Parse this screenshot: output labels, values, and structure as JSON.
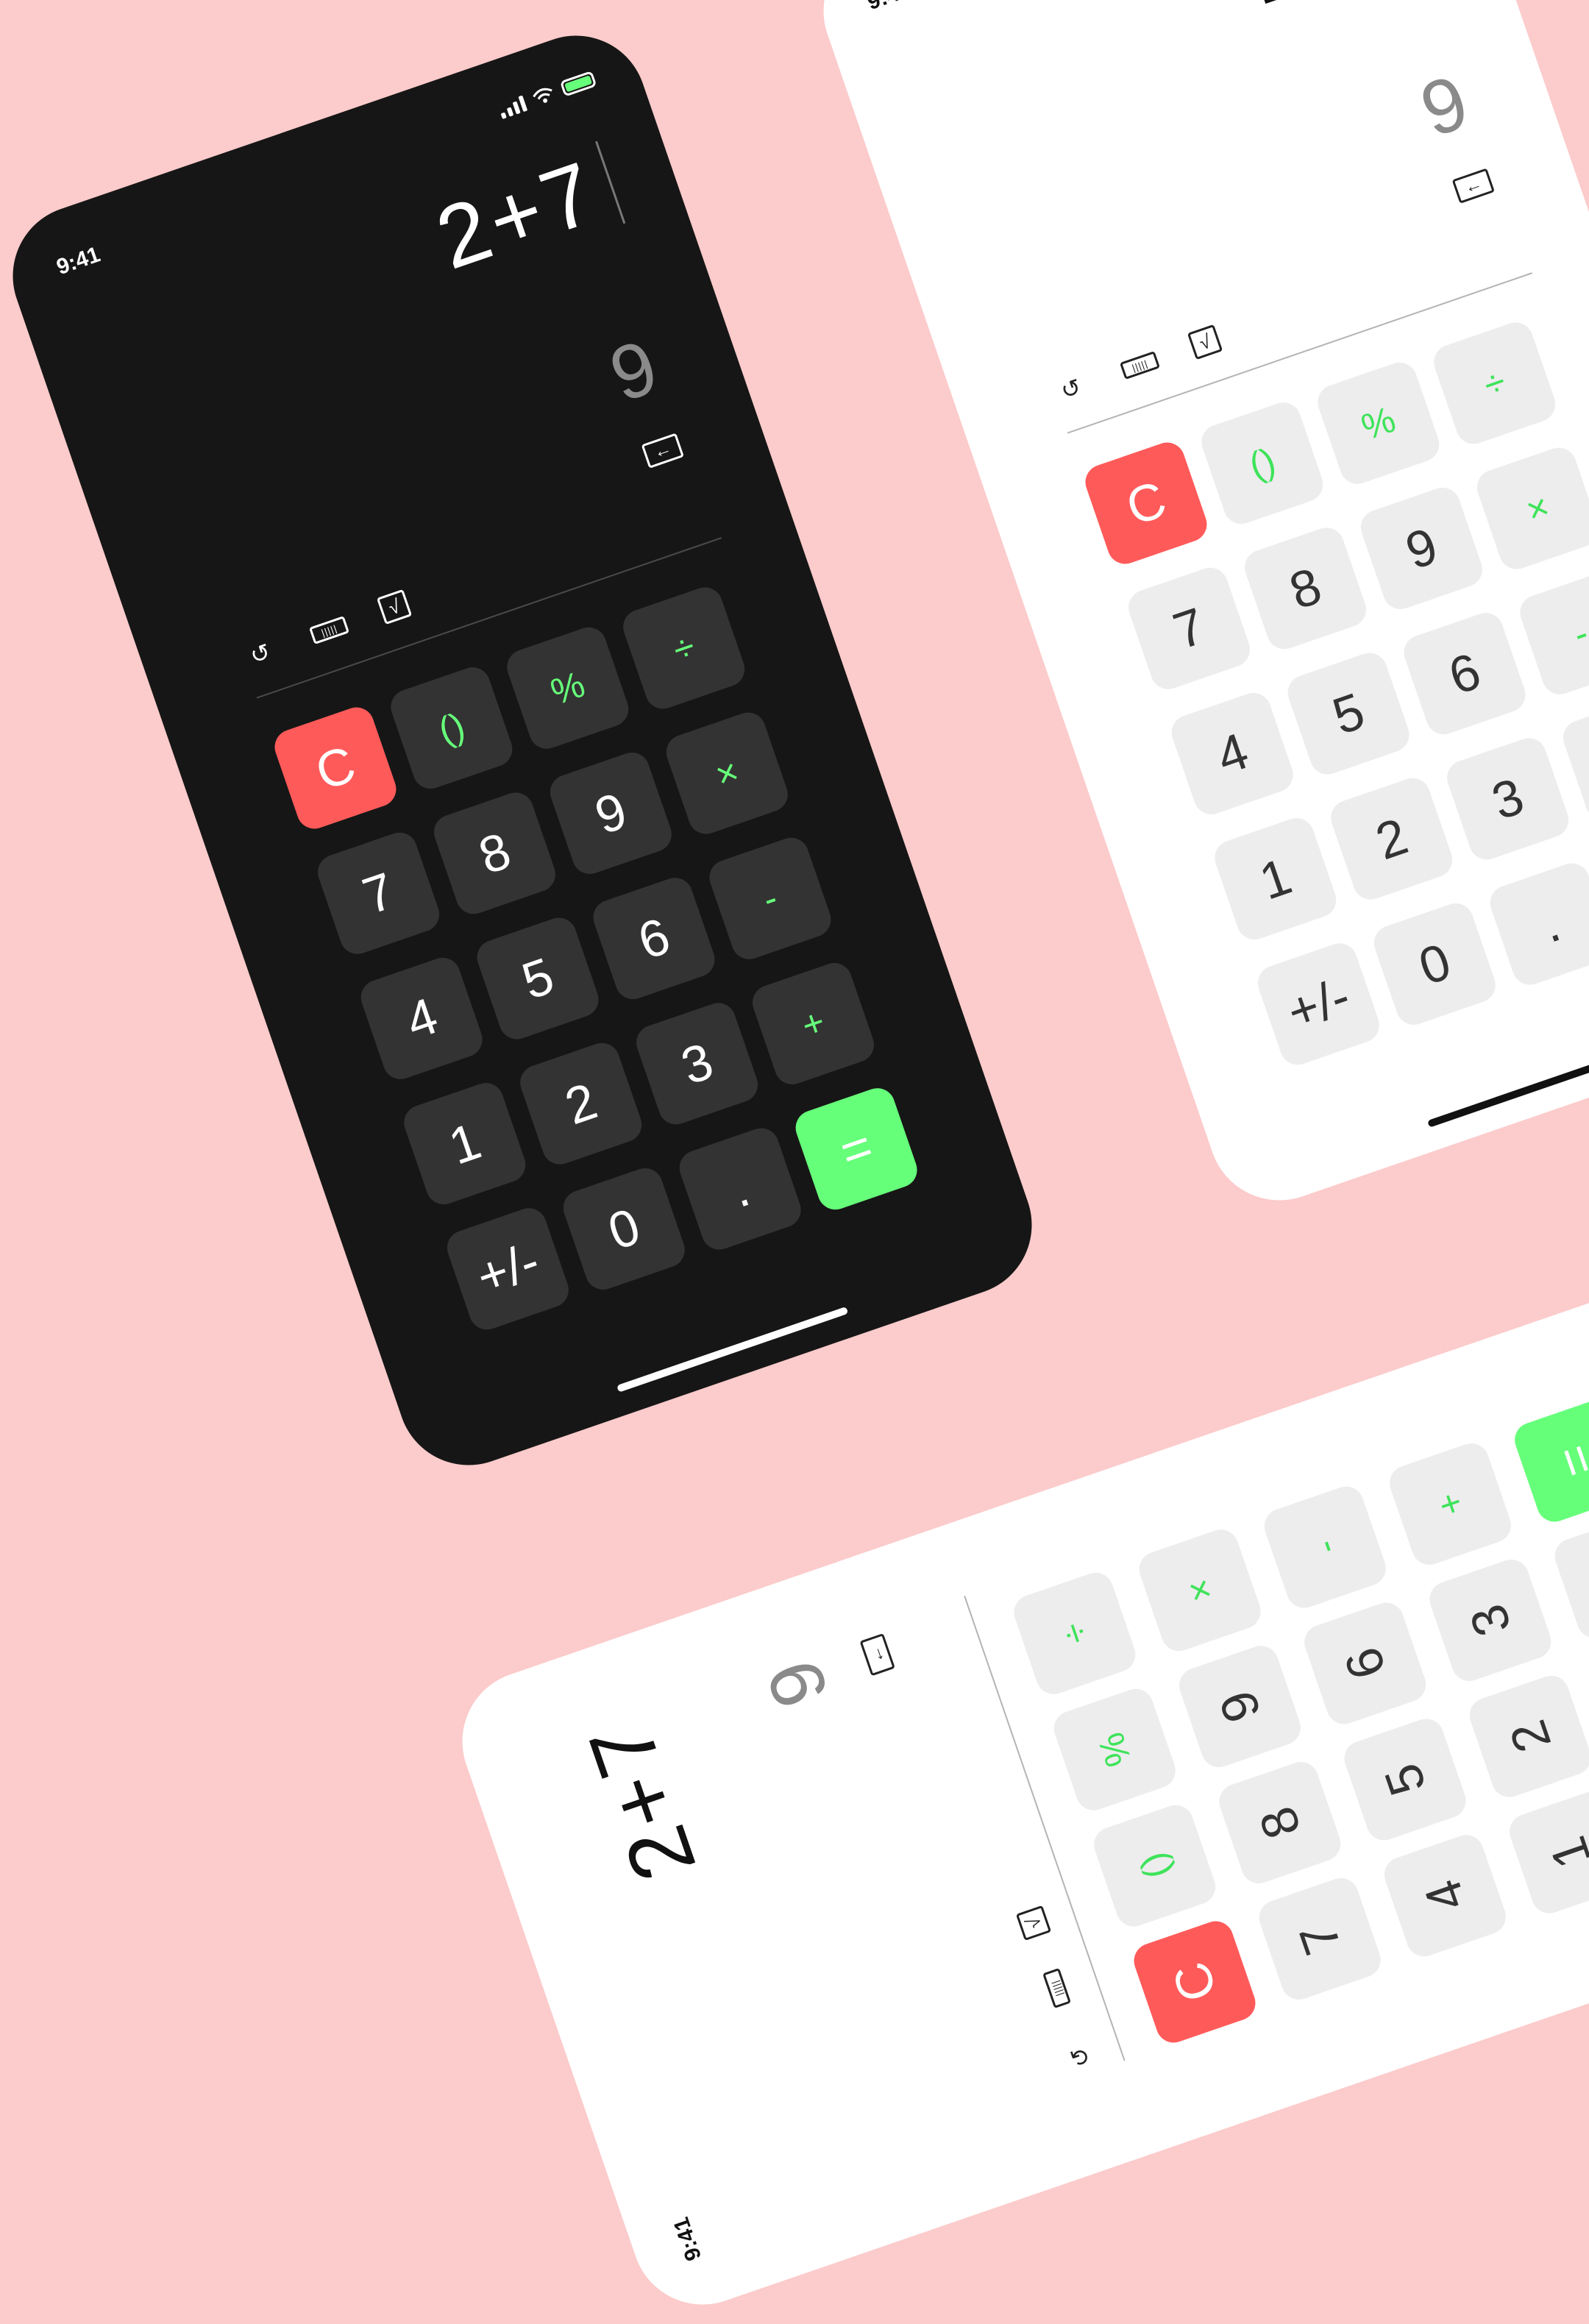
{
  "status": {
    "time": "9:41"
  },
  "display": {
    "expression": "2+7",
    "result": "9"
  },
  "controls": {
    "backspace_glyph": "←",
    "history_glyph": "↺",
    "ruler_glyph": "|||||",
    "root_glyph": "√"
  },
  "keypad": {
    "row1": [
      "C",
      "()",
      "%",
      "÷"
    ],
    "row2": [
      "7",
      "8",
      "9",
      "×"
    ],
    "row3": [
      "4",
      "5",
      "6",
      "-"
    ],
    "row4": [
      "1",
      "2",
      "3",
      "+"
    ],
    "row5": [
      "+/-",
      "0",
      ".",
      "="
    ]
  },
  "colors": {
    "background": "#fccbcb",
    "dark_body": "#161616",
    "dark_key": "#333333",
    "light_key": "#ededed",
    "accent_green": "#66ff7a",
    "clear_red": "#ff5a5a"
  }
}
